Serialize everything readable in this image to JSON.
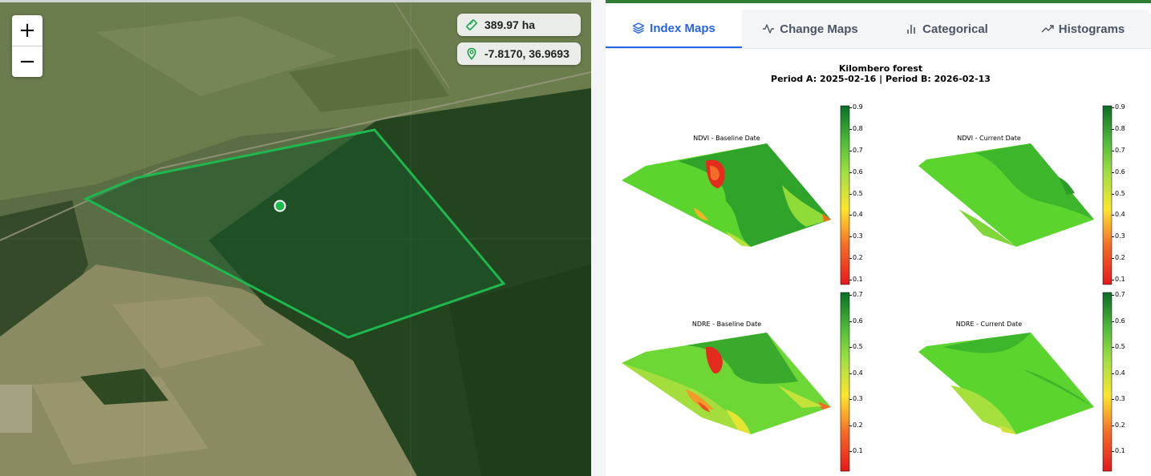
{
  "map": {
    "zoom_in_label": "+",
    "zoom_out_label": "−",
    "area_label": "389.97 ha",
    "coord_label": "-7.8170, 36.9693",
    "polygon_color": "#1fb84f"
  },
  "tabs": [
    {
      "label": "Index Maps",
      "icon": "layers-icon",
      "active": true
    },
    {
      "label": "Change Maps",
      "icon": "activity-icon",
      "active": false
    },
    {
      "label": "Categorical",
      "icon": "bar-chart-icon",
      "active": false
    },
    {
      "label": "Histograms",
      "icon": "trending-up-icon",
      "active": false
    }
  ],
  "figure": {
    "title": "Kilombero forest",
    "subtitle": "Period A: 2025-02-16 | Period B: 2026-02-13",
    "panels": [
      {
        "title": "NDVI - Baseline Date",
        "ticks": [
          "0.9",
          "0.8",
          "0.7",
          "0.6",
          "0.5",
          "0.4",
          "0.3",
          "0.2",
          "0.1"
        ]
      },
      {
        "title": "NDVI - Current Date",
        "ticks": [
          "0.9",
          "0.8",
          "0.7",
          "0.6",
          "0.5",
          "0.4",
          "0.3",
          "0.2",
          "0.1"
        ]
      },
      {
        "title": "NDRE - Baseline Date",
        "ticks": [
          "0.7",
          "0.6",
          "0.5",
          "0.4",
          "0.3",
          "0.2",
          "0.1"
        ]
      },
      {
        "title": "NDRE - Current Date",
        "ticks": [
          "0.7",
          "0.6",
          "0.5",
          "0.4",
          "0.3",
          "0.2",
          "0.1"
        ]
      }
    ],
    "colormap": [
      "#d7191c",
      "#f46d43",
      "#fdd835",
      "#7fd63b",
      "#1a7a2e"
    ]
  }
}
